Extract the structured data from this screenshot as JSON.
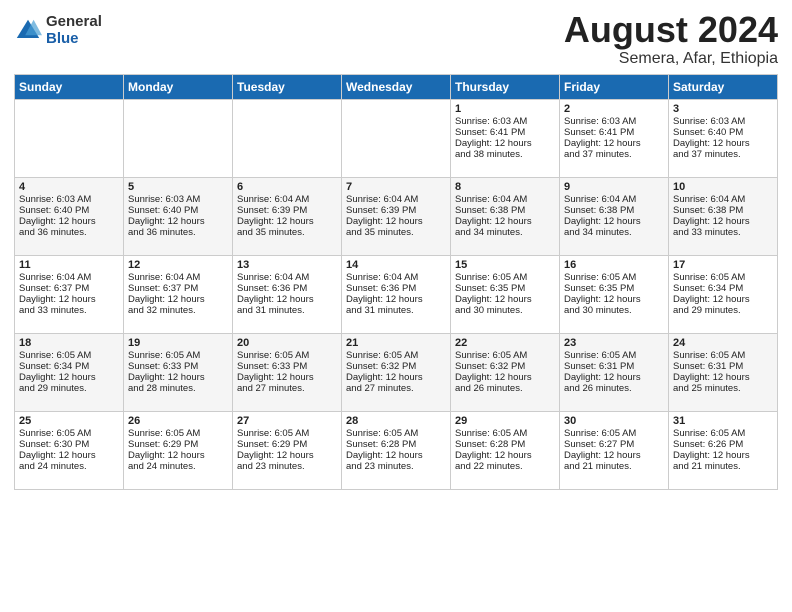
{
  "header": {
    "logo_general": "General",
    "logo_blue": "Blue",
    "title": "August 2024",
    "subtitle": "Semera, Afar, Ethiopia"
  },
  "weekdays": [
    "Sunday",
    "Monday",
    "Tuesday",
    "Wednesday",
    "Thursday",
    "Friday",
    "Saturday"
  ],
  "weeks": [
    [
      {
        "day": "",
        "content": ""
      },
      {
        "day": "",
        "content": ""
      },
      {
        "day": "",
        "content": ""
      },
      {
        "day": "",
        "content": ""
      },
      {
        "day": "1",
        "content": "Sunrise: 6:03 AM\nSunset: 6:41 PM\nDaylight: 12 hours\nand 38 minutes."
      },
      {
        "day": "2",
        "content": "Sunrise: 6:03 AM\nSunset: 6:41 PM\nDaylight: 12 hours\nand 37 minutes."
      },
      {
        "day": "3",
        "content": "Sunrise: 6:03 AM\nSunset: 6:40 PM\nDaylight: 12 hours\nand 37 minutes."
      }
    ],
    [
      {
        "day": "4",
        "content": "Sunrise: 6:03 AM\nSunset: 6:40 PM\nDaylight: 12 hours\nand 36 minutes."
      },
      {
        "day": "5",
        "content": "Sunrise: 6:03 AM\nSunset: 6:40 PM\nDaylight: 12 hours\nand 36 minutes."
      },
      {
        "day": "6",
        "content": "Sunrise: 6:04 AM\nSunset: 6:39 PM\nDaylight: 12 hours\nand 35 minutes."
      },
      {
        "day": "7",
        "content": "Sunrise: 6:04 AM\nSunset: 6:39 PM\nDaylight: 12 hours\nand 35 minutes."
      },
      {
        "day": "8",
        "content": "Sunrise: 6:04 AM\nSunset: 6:38 PM\nDaylight: 12 hours\nand 34 minutes."
      },
      {
        "day": "9",
        "content": "Sunrise: 6:04 AM\nSunset: 6:38 PM\nDaylight: 12 hours\nand 34 minutes."
      },
      {
        "day": "10",
        "content": "Sunrise: 6:04 AM\nSunset: 6:38 PM\nDaylight: 12 hours\nand 33 minutes."
      }
    ],
    [
      {
        "day": "11",
        "content": "Sunrise: 6:04 AM\nSunset: 6:37 PM\nDaylight: 12 hours\nand 33 minutes."
      },
      {
        "day": "12",
        "content": "Sunrise: 6:04 AM\nSunset: 6:37 PM\nDaylight: 12 hours\nand 32 minutes."
      },
      {
        "day": "13",
        "content": "Sunrise: 6:04 AM\nSunset: 6:36 PM\nDaylight: 12 hours\nand 31 minutes."
      },
      {
        "day": "14",
        "content": "Sunrise: 6:04 AM\nSunset: 6:36 PM\nDaylight: 12 hours\nand 31 minutes."
      },
      {
        "day": "15",
        "content": "Sunrise: 6:05 AM\nSunset: 6:35 PM\nDaylight: 12 hours\nand 30 minutes."
      },
      {
        "day": "16",
        "content": "Sunrise: 6:05 AM\nSunset: 6:35 PM\nDaylight: 12 hours\nand 30 minutes."
      },
      {
        "day": "17",
        "content": "Sunrise: 6:05 AM\nSunset: 6:34 PM\nDaylight: 12 hours\nand 29 minutes."
      }
    ],
    [
      {
        "day": "18",
        "content": "Sunrise: 6:05 AM\nSunset: 6:34 PM\nDaylight: 12 hours\nand 29 minutes."
      },
      {
        "day": "19",
        "content": "Sunrise: 6:05 AM\nSunset: 6:33 PM\nDaylight: 12 hours\nand 28 minutes."
      },
      {
        "day": "20",
        "content": "Sunrise: 6:05 AM\nSunset: 6:33 PM\nDaylight: 12 hours\nand 27 minutes."
      },
      {
        "day": "21",
        "content": "Sunrise: 6:05 AM\nSunset: 6:32 PM\nDaylight: 12 hours\nand 27 minutes."
      },
      {
        "day": "22",
        "content": "Sunrise: 6:05 AM\nSunset: 6:32 PM\nDaylight: 12 hours\nand 26 minutes."
      },
      {
        "day": "23",
        "content": "Sunrise: 6:05 AM\nSunset: 6:31 PM\nDaylight: 12 hours\nand 26 minutes."
      },
      {
        "day": "24",
        "content": "Sunrise: 6:05 AM\nSunset: 6:31 PM\nDaylight: 12 hours\nand 25 minutes."
      }
    ],
    [
      {
        "day": "25",
        "content": "Sunrise: 6:05 AM\nSunset: 6:30 PM\nDaylight: 12 hours\nand 24 minutes."
      },
      {
        "day": "26",
        "content": "Sunrise: 6:05 AM\nSunset: 6:29 PM\nDaylight: 12 hours\nand 24 minutes."
      },
      {
        "day": "27",
        "content": "Sunrise: 6:05 AM\nSunset: 6:29 PM\nDaylight: 12 hours\nand 23 minutes."
      },
      {
        "day": "28",
        "content": "Sunrise: 6:05 AM\nSunset: 6:28 PM\nDaylight: 12 hours\nand 23 minutes."
      },
      {
        "day": "29",
        "content": "Sunrise: 6:05 AM\nSunset: 6:28 PM\nDaylight: 12 hours\nand 22 minutes."
      },
      {
        "day": "30",
        "content": "Sunrise: 6:05 AM\nSunset: 6:27 PM\nDaylight: 12 hours\nand 21 minutes."
      },
      {
        "day": "31",
        "content": "Sunrise: 6:05 AM\nSunset: 6:26 PM\nDaylight: 12 hours\nand 21 minutes."
      }
    ]
  ]
}
